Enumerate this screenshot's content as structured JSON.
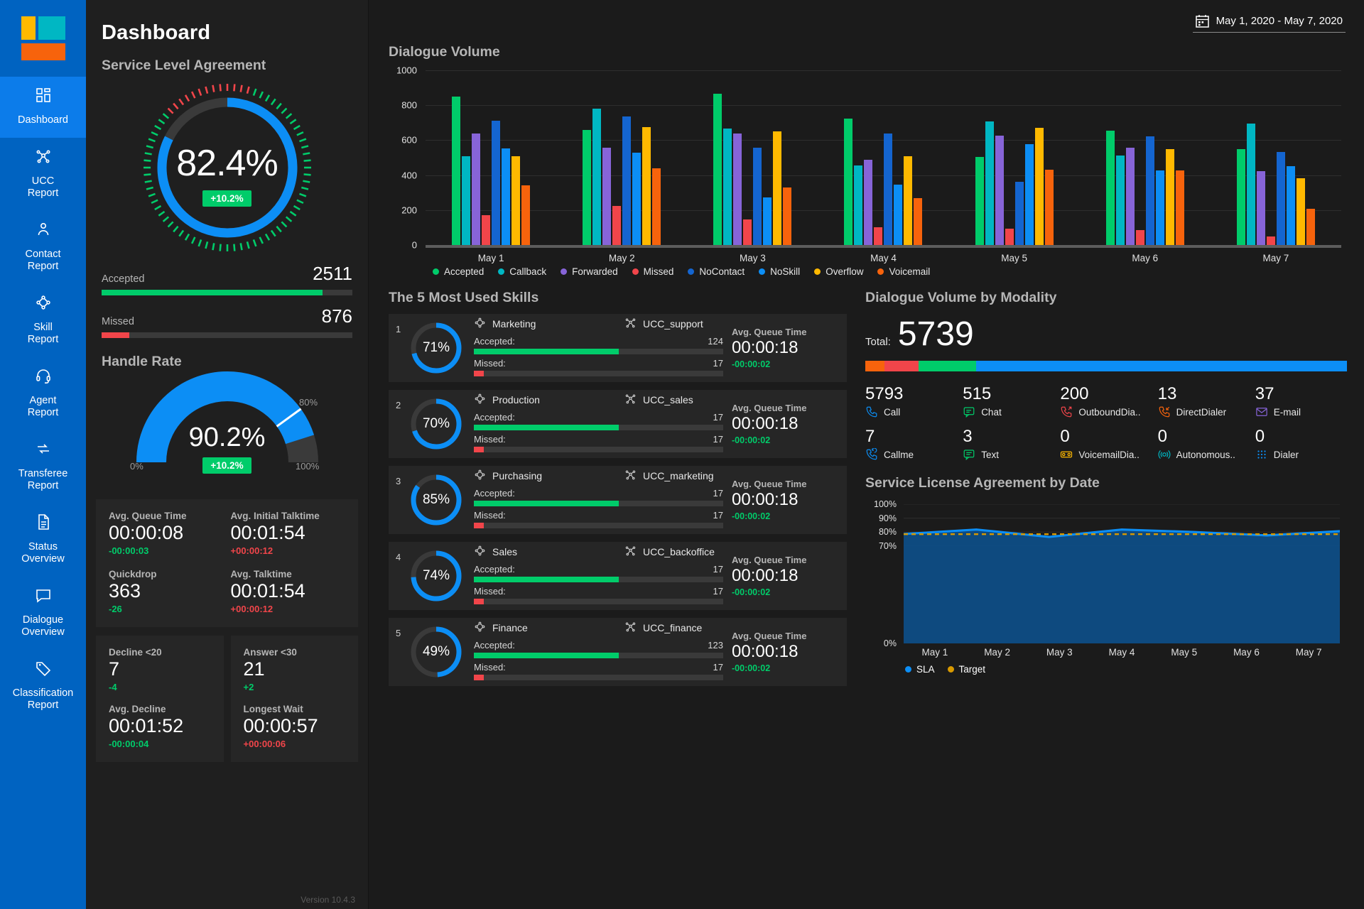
{
  "sidebar": {
    "logo_name": "app-logo",
    "items": [
      {
        "label": "Dashboard",
        "icon": "grid-icon",
        "active": true
      },
      {
        "label": "UCC\nReport",
        "icon": "network-icon",
        "active": false
      },
      {
        "label": "Contact\nReport",
        "icon": "person-icon",
        "active": false
      },
      {
        "label": "Skill\nReport",
        "icon": "skill-nodes-icon",
        "active": false
      },
      {
        "label": "Agent\nReport",
        "icon": "headset-icon",
        "active": false
      },
      {
        "label": "Transferee\nReport",
        "icon": "transfer-arrows-icon",
        "active": false
      },
      {
        "label": "Status\nOverview",
        "icon": "document-icon",
        "active": false
      },
      {
        "label": "Dialogue\nOverview",
        "icon": "chat-icon",
        "active": false
      },
      {
        "label": "Classification\nReport",
        "icon": "tag-icon",
        "active": false
      }
    ]
  },
  "header": {
    "page_title": "Dashboard",
    "date_range": "May 1, 2020 - May 7, 2020",
    "calendar_icon": "calendar-icon"
  },
  "sla": {
    "section_title": "Service Level Agreement",
    "value": "82.4%",
    "value_pct": 82.4,
    "delta": "+10.2%",
    "accepted_label": "Accepted",
    "accepted_value": "2511",
    "accepted_pct": 88,
    "missed_label": "Missed",
    "missed_value": "876",
    "missed_pct": 11
  },
  "handle_rate": {
    "section_title": "Handle Rate",
    "value": "90.2%",
    "value_pct": 90.2,
    "delta": "+10.2%",
    "scale_min": "0%",
    "scale_max": "100%",
    "target_label": "80%"
  },
  "kpis": [
    {
      "label": "Avg. Queue Time",
      "value": "00:00:08",
      "delta": "-00:00:03",
      "dir": "down"
    },
    {
      "label": "Avg. Initial Talktime",
      "value": "00:01:54",
      "delta": "+00:00:12",
      "dir": "up"
    },
    {
      "label": "Quickdrop",
      "value": "363",
      "delta": "-26",
      "dir": "down"
    },
    {
      "label": "Avg. Talktime",
      "value": "00:01:54",
      "delta": "+00:00:12",
      "dir": "up"
    }
  ],
  "kpis_row2": [
    {
      "label": "Decline <20",
      "value": "7",
      "delta": "-4",
      "dir": "down",
      "label2": "Avg. Decline",
      "value2": "00:01:52",
      "delta2": "-00:00:04",
      "dir2": "down"
    },
    {
      "label": "Answer <30",
      "value": "21",
      "delta": "+2",
      "dir": "down",
      "label2": "Longest Wait",
      "value2": "00:00:57",
      "delta2": "+00:00:06",
      "dir2": "up"
    }
  ],
  "version": "Version 10.4.3",
  "chart_data": [
    {
      "type": "bar",
      "title": "Dialogue Volume",
      "xlabel": "",
      "ylabel": "",
      "ylim": [
        0,
        1000
      ],
      "yticks": [
        0,
        200,
        400,
        600,
        800,
        1000
      ],
      "grid": true,
      "legend_position": "bottom",
      "categories": [
        "May 1",
        "May 2",
        "May 3",
        "May 4",
        "May 5",
        "May 6",
        "May 7"
      ],
      "series": [
        {
          "name": "Accepted",
          "color": "#00cc6a",
          "values": [
            848,
            660,
            865,
            722,
            506,
            655,
            548
          ]
        },
        {
          "name": "Callback",
          "color": "#00b7c3",
          "values": [
            508,
            780,
            668,
            455,
            708,
            512,
            695
          ]
        },
        {
          "name": "Forwarded",
          "color": "#8764d8",
          "values": [
            637,
            557,
            640,
            488,
            628,
            558,
            424
          ]
        },
        {
          "name": "Missed",
          "color": "#f1454a",
          "values": [
            172,
            225,
            145,
            102,
            94,
            85,
            50
          ]
        },
        {
          "name": "NoContact",
          "color": "#1465d0",
          "values": [
            712,
            735,
            557,
            637,
            362,
            620,
            532
          ]
        },
        {
          "name": "NoSkill",
          "color": "#0c8ef5",
          "values": [
            551,
            527,
            272,
            345,
            577,
            428,
            452
          ]
        },
        {
          "name": "Overflow",
          "color": "#ffb900",
          "values": [
            508,
            675,
            650,
            510,
            672,
            550,
            383
          ]
        },
        {
          "name": "Voicemail",
          "color": "#f7630c",
          "values": [
            342,
            440,
            330,
            268,
            432,
            428,
            208
          ]
        }
      ]
    },
    {
      "type": "area",
      "title": "Service License Agreement by Date",
      "xlabel": "",
      "ylabel": "",
      "ylim": [
        0,
        100
      ],
      "yticks": [
        0,
        70,
        80,
        90,
        100
      ],
      "ytick_labels": [
        "0%",
        "70%",
        "80%",
        "90%",
        "100%"
      ],
      "grid": true,
      "legend_position": "bottom",
      "x": [
        "May 1",
        "May 2",
        "May 3",
        "May 4",
        "May 5",
        "May 6",
        "May 7"
      ],
      "series": [
        {
          "name": "SLA",
          "color": "#0c8ef5",
          "values": [
            78.6,
            81.8,
            76.5,
            81.8,
            80.0,
            77.6,
            80.6
          ]
        },
        {
          "name": "Target",
          "color": "#d99a00",
          "style": "dashed",
          "values": [
            78.5,
            78.5,
            78.5,
            78.5,
            78.5,
            78.5,
            78.5
          ]
        }
      ]
    }
  ],
  "skills": {
    "title": "The 5 Most Used Skills",
    "accepted_label": "Accepted:",
    "missed_label": "Missed:",
    "queue_label": "Avg. Queue Time",
    "rows": [
      {
        "rank": "1",
        "pct": "71%",
        "pct_val": 71,
        "skill": "Marketing",
        "ucc": "UCC_support",
        "accepted": "124",
        "accepted_pct": 58,
        "missed": "17",
        "missed_pct": 4,
        "queue": "00:00:18",
        "delta": "-00:00:02",
        "dir": "down"
      },
      {
        "rank": "2",
        "pct": "70%",
        "pct_val": 70,
        "skill": "Production",
        "ucc": "UCC_sales",
        "accepted": "17",
        "accepted_pct": 58,
        "missed": "17",
        "missed_pct": 4,
        "queue": "00:00:18",
        "delta": "-00:00:02",
        "dir": "down"
      },
      {
        "rank": "3",
        "pct": "85%",
        "pct_val": 85,
        "skill": "Purchasing",
        "ucc": "UCC_marketing",
        "accepted": "17",
        "accepted_pct": 58,
        "missed": "17",
        "missed_pct": 4,
        "queue": "00:00:18",
        "delta": "-00:00:02",
        "dir": "down"
      },
      {
        "rank": "4",
        "pct": "74%",
        "pct_val": 74,
        "skill": "Sales",
        "ucc": "UCC_backoffice",
        "accepted": "17",
        "accepted_pct": 58,
        "missed": "17",
        "missed_pct": 4,
        "queue": "00:00:18",
        "delta": "-00:00:02",
        "dir": "down"
      },
      {
        "rank": "5",
        "pct": "49%",
        "pct_val": 49,
        "skill": "Finance",
        "ucc": "UCC_finance",
        "accepted": "123",
        "accepted_pct": 58,
        "missed": "17",
        "missed_pct": 4,
        "queue": "00:00:18",
        "delta": "-00:00:02",
        "dir": "down"
      }
    ]
  },
  "modality": {
    "title": "Dialogue Volume by Modality",
    "total_label": "Total:",
    "total_value": "5739",
    "stack": [
      {
        "color": "#f7630c",
        "pct": 4
      },
      {
        "color": "#f1454a",
        "pct": 7
      },
      {
        "color": "#00cc6a",
        "pct": 12
      },
      {
        "color": "#0c8ef5",
        "pct": 77
      }
    ],
    "cells": [
      {
        "value": "5793",
        "label": "Call",
        "icon": "phone-icon",
        "color": "#0c8ef5"
      },
      {
        "value": "515",
        "label": "Chat",
        "icon": "chat-bubble-icon",
        "color": "#00cc6a"
      },
      {
        "value": "200",
        "label": "OutboundDia..",
        "icon": "phone-outbound-icon",
        "color": "#f1454a"
      },
      {
        "value": "13",
        "label": "DirectDialer",
        "icon": "phone-inbound-icon",
        "color": "#f7630c"
      },
      {
        "value": "37",
        "label": "E-mail",
        "icon": "envelope-icon",
        "color": "#8764d8"
      },
      {
        "value": "7",
        "label": "Callme",
        "icon": "phone-callback-icon",
        "color": "#0c8ef5"
      },
      {
        "value": "3",
        "label": "Text",
        "icon": "text-message-icon",
        "color": "#00cc6a"
      },
      {
        "value": "0",
        "label": "VoicemailDia..",
        "icon": "voicemail-icon",
        "color": "#ffb900"
      },
      {
        "value": "0",
        "label": "Autonomous..",
        "icon": "broadcast-icon",
        "color": "#00b7c3"
      },
      {
        "value": "0",
        "label": "Dialer",
        "icon": "keypad-icon",
        "color": "#0c8ef5"
      }
    ]
  }
}
